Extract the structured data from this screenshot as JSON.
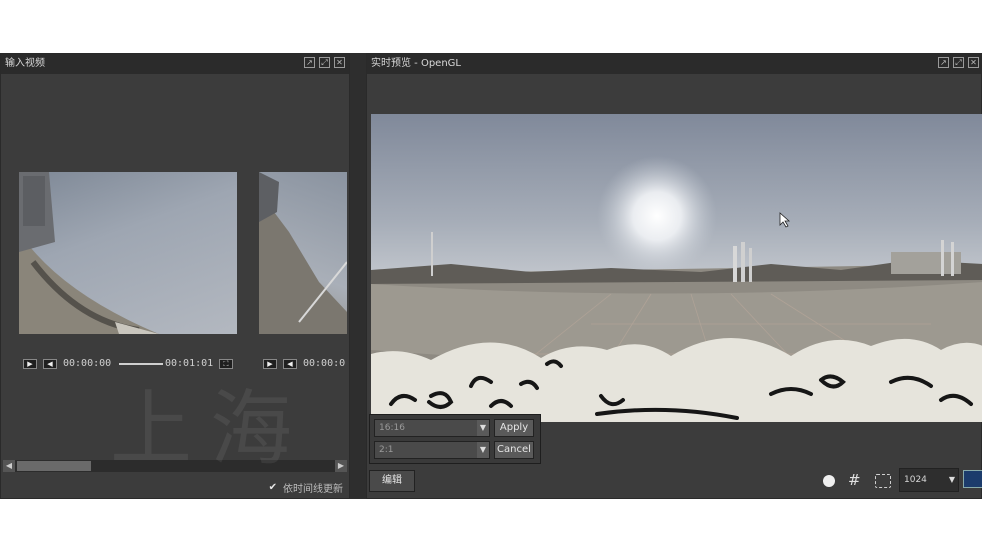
{
  "input_panel": {
    "title": "输入视频",
    "clip1": {
      "time_current": "00:00:00",
      "time_total": "00:01:01"
    },
    "clip2": {
      "time_current": "00:00:0"
    },
    "update_checkbox_label": "依时间线更新"
  },
  "preview_panel": {
    "title": "实时预览 - OpenGL",
    "ratio_select": "16:16",
    "scale_select": "2:1",
    "apply_label": "Apply",
    "cancel_label": "Cancel",
    "edit_label": "编辑",
    "resolution_select": "1024"
  },
  "watermark": "上海",
  "colors": {
    "panel_bg": "#3c3c3c",
    "titlebar_bg": "#2b2b2b",
    "sky": "#a8b0bc",
    "ground": "#8f8c84"
  }
}
